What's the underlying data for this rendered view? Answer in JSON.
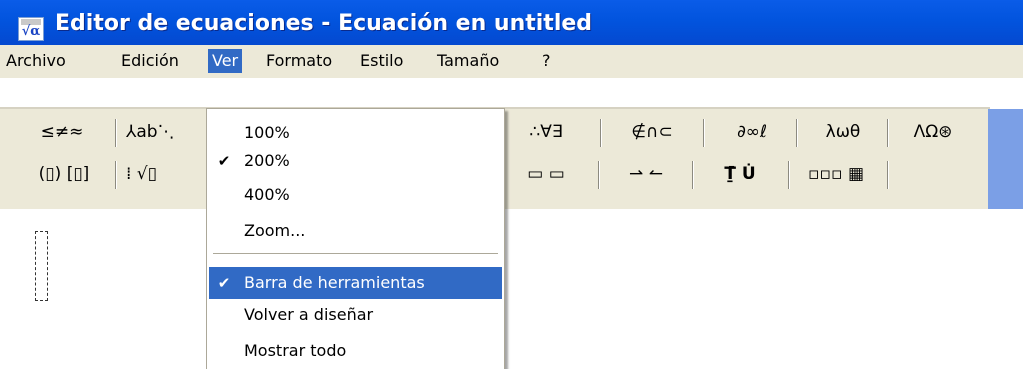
{
  "window": {
    "title": "Editor de ecuaciones - Ecuación en untitled",
    "icon": "equation-editor-icon",
    "icon_glyph": "√α"
  },
  "menubar": {
    "items": [
      {
        "label": "Archivo"
      },
      {
        "label": "Edición"
      },
      {
        "label": "Ver"
      },
      {
        "label": "Formato"
      },
      {
        "label": "Estilo"
      },
      {
        "label": "Tamaño"
      },
      {
        "label": "?"
      }
    ],
    "active": "Ver"
  },
  "toolbar": {
    "row1": [
      {
        "glyphs": "≤≠≈",
        "icon": "relations-palette-icon"
      },
      {
        "glyphs": "⅄ab⋱",
        "icon": "spaces-ellipses-palette-icon"
      },
      {
        "glyphs": "∴∀∃",
        "icon": "logic-palette-icon"
      },
      {
        "glyphs": "∉∩⊂",
        "icon": "set-theory-palette-icon"
      },
      {
        "glyphs": "∂∞ℓ",
        "icon": "misc-symbols-palette-icon"
      },
      {
        "glyphs": "λωθ",
        "icon": "greek-lowercase-palette-icon"
      },
      {
        "glyphs": "ΛΩ⊛",
        "icon": "greek-uppercase-palette-icon"
      }
    ],
    "row2": [
      {
        "glyphs": "(▯) [▯]",
        "icon": "fences-palette-icon"
      },
      {
        "glyphs": "⁞ √▯",
        "icon": "fractions-radicals-palette-icon"
      },
      {
        "glyphs": "▭ ▭",
        "icon": "over-under-bar-palette-icon"
      },
      {
        "glyphs": "⇀ ↼",
        "icon": "arrows-palette-icon"
      },
      {
        "glyphs": "Ṯ̄ U̇",
        "icon": "products-sets-palette-icon"
      },
      {
        "glyphs": "▫▫▫ ▦",
        "icon": "matrix-palette-icon"
      }
    ]
  },
  "ver_menu": {
    "items": [
      {
        "label": "100%",
        "checked": false
      },
      {
        "label": "200%",
        "checked": true
      },
      {
        "label": "400%",
        "checked": false
      },
      {
        "label": "Zoom...",
        "checked": false
      },
      {
        "label": "Barra de herramientas",
        "checked": true,
        "highlighted": true
      },
      {
        "label": "Volver a diseñar",
        "checked": false
      },
      {
        "label": "Mostrar todo",
        "checked": false
      }
    ],
    "check_mark": "✔"
  },
  "colors": {
    "titlebar": "#0254de",
    "menu_highlight": "#316ac5",
    "face": "#ece9d8",
    "toolbar_accent": "#7b9fe6"
  }
}
